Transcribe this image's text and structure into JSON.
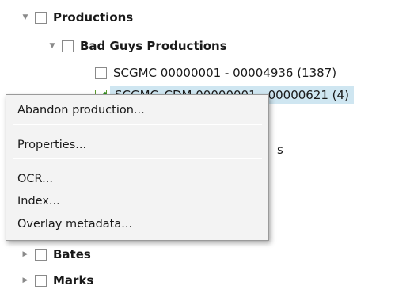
{
  "tree": {
    "productions": {
      "label": "Productions",
      "arrow": "▼"
    },
    "bad_guys": {
      "label": "Bad Guys Productions",
      "arrow": "▼"
    },
    "item1": {
      "label": "SCGMC 00000001 - 00004936 (1387)"
    },
    "item2": {
      "label": "SCGMC_CDM 00000001 - 00000621 (4)"
    },
    "partial_s": {
      "label": "s"
    },
    "bates": {
      "label": "Bates",
      "arrow": "▶"
    },
    "marks": {
      "label": "Marks",
      "arrow": "▶"
    }
  },
  "context_menu": {
    "items": [
      {
        "label": "Abandon production..."
      },
      {
        "label": "Properties..."
      },
      {
        "label": "OCR..."
      },
      {
        "label": "Index..."
      },
      {
        "label": "Overlay metadata..."
      }
    ]
  }
}
